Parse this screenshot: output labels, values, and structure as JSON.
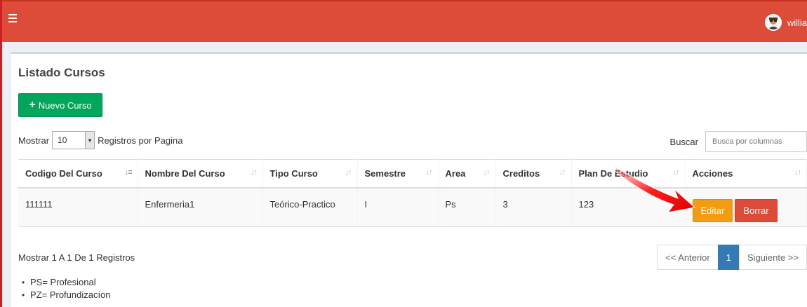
{
  "topbar": {
    "user_name": "willia",
    "color": "#dd4b39"
  },
  "box": {
    "title": "Listado Cursos",
    "new_button": "Nuevo Curso",
    "length_prefix": "Mostrar",
    "length_value": "10",
    "length_suffix": "Registros por Pagina",
    "search_label": "Buscar",
    "search_placeholder": "Busca por columnas"
  },
  "table": {
    "columns": [
      "Codigo Del Curso",
      "Nombre Del Curso",
      "Tipo Curso",
      "Semestre",
      "Area",
      "Creditos",
      "Plan De Estudio",
      "Acciones"
    ],
    "rows": [
      {
        "codigo": "111111",
        "nombre": "Enfermeria1",
        "tipo": "Teórico-Practico",
        "semestre": "I",
        "area": "Ps",
        "creditos": "3",
        "plan": "123"
      }
    ],
    "edit_label": "Editar",
    "delete_label": "Borrar"
  },
  "footer": {
    "info": "Mostrar 1 A 1 De 1 Registros",
    "prev": "<< Anterior",
    "page": "1",
    "next": "Siguiente >>"
  },
  "notes": [
    "PS= Profesional",
    "PZ= Profundizacíon"
  ],
  "colors": {
    "success": "#00a65a",
    "warning": "#f39c12",
    "danger": "#dd4b39",
    "primary": "#337ab7",
    "annotation_arrow": "#ff1a1a"
  }
}
